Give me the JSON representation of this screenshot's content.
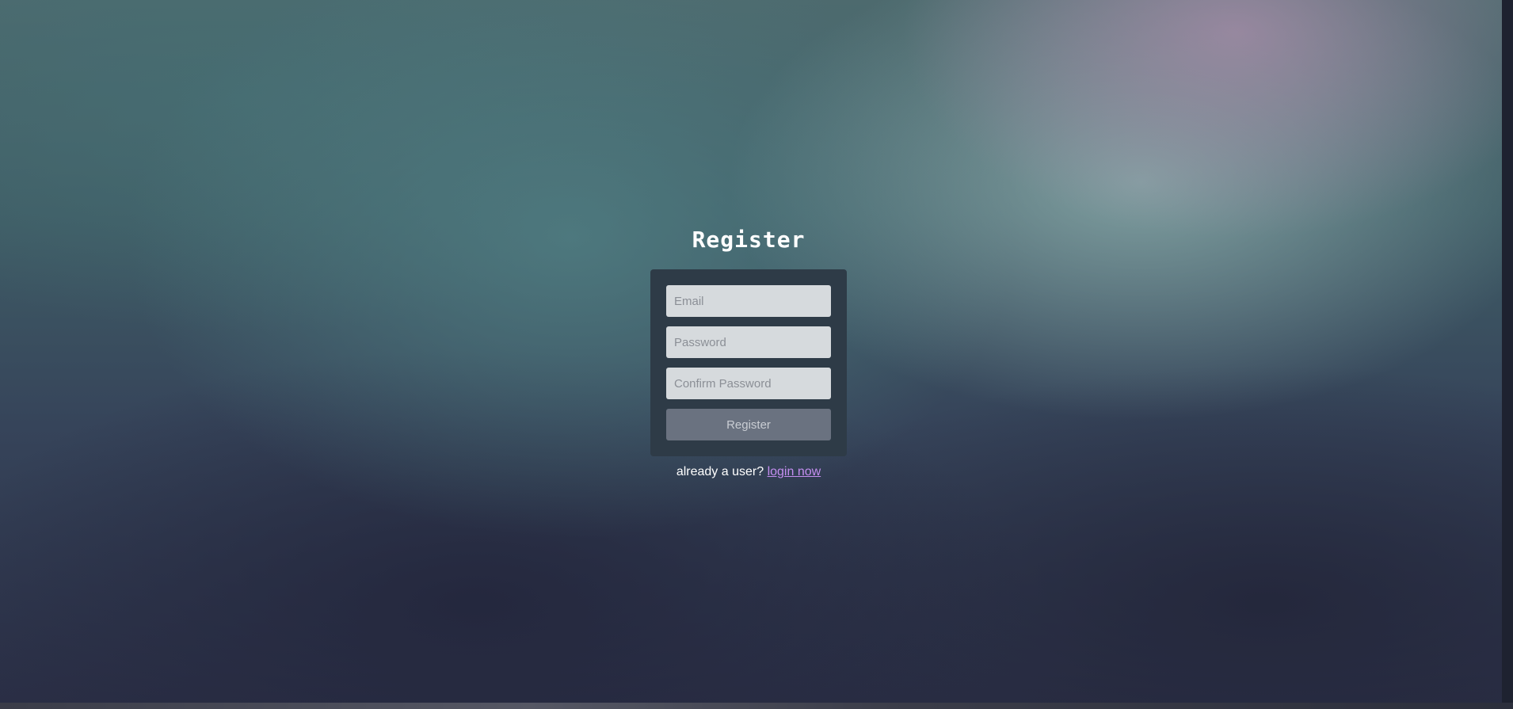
{
  "form": {
    "title": "Register",
    "email_placeholder": "Email",
    "password_placeholder": "Password",
    "confirm_placeholder": "Confirm Password",
    "submit_label": "Register"
  },
  "footer": {
    "prompt": "already a user?",
    "link_label": "login now"
  },
  "colors": {
    "card": "#2e3b47",
    "button": "#6a7280",
    "link": "#c48ef0"
  }
}
